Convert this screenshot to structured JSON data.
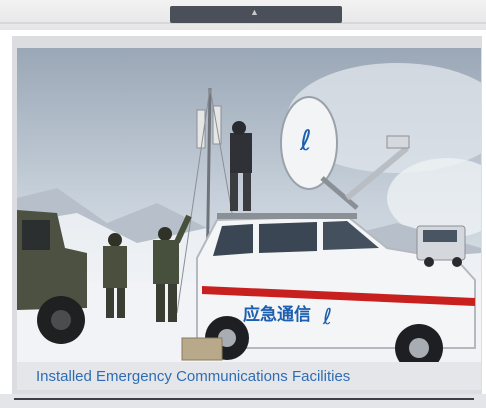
{
  "header": {
    "tab_glyph": "▲"
  },
  "figure": {
    "caption": "Installed Emergency Communications Facilities",
    "vehicle_text": "应急通信"
  },
  "colors": {
    "caption_text": "#2e6db4",
    "top_tab": "#4a4f59",
    "vehicle_stripe": "#c8201e",
    "telecom_blue": "#1c5fb0"
  }
}
